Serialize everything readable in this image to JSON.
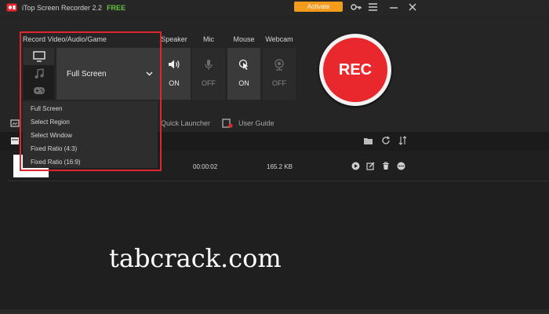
{
  "app": {
    "title": "iTop Screen Recorder 2.2",
    "edition": "FREE",
    "activate_label": "Activate"
  },
  "titlebar_icons": [
    "key-icon",
    "menu-icon",
    "minimize-icon",
    "close-icon"
  ],
  "record_mode": {
    "label": "Record Video/Audio/Game",
    "selected": "Full Screen",
    "mode_icons": [
      "monitor-icon",
      "music-icon",
      "gamepad-icon"
    ],
    "options": [
      "Full Screen",
      "Select Region",
      "Select Window",
      "Fixed Ratio (4:3)",
      "Fixed Ratio (16:9)"
    ]
  },
  "devices": [
    {
      "name": "Speaker",
      "state": "ON",
      "icon": "speaker-icon"
    },
    {
      "name": "Mic",
      "state": "OFF",
      "icon": "mic-icon"
    },
    {
      "name": "Mouse",
      "state": "ON",
      "icon": "mouse-icon"
    },
    {
      "name": "Webcam",
      "state": "OFF",
      "icon": "webcam-icon"
    }
  ],
  "rec_button": {
    "label": "REC"
  },
  "toolbar": {
    "quick_launcher": "Quick Launcher",
    "user_guide": "User Guide"
  },
  "file_list": {
    "header_icons": [
      "folder-icon",
      "refresh-icon",
      "sort-icon"
    ],
    "rows": [
      {
        "duration": "00:00:02",
        "size": "165.2 KB"
      }
    ],
    "row_actions": [
      "play-icon",
      "edit-icon",
      "delete-icon",
      "more-icon"
    ]
  },
  "watermark": "tabcrack.com",
  "colors": {
    "accent_orange": "#f39b1c",
    "rec_red": "#e8282c",
    "free_green": "#63c23f",
    "highlight_red": "#e0252d"
  }
}
